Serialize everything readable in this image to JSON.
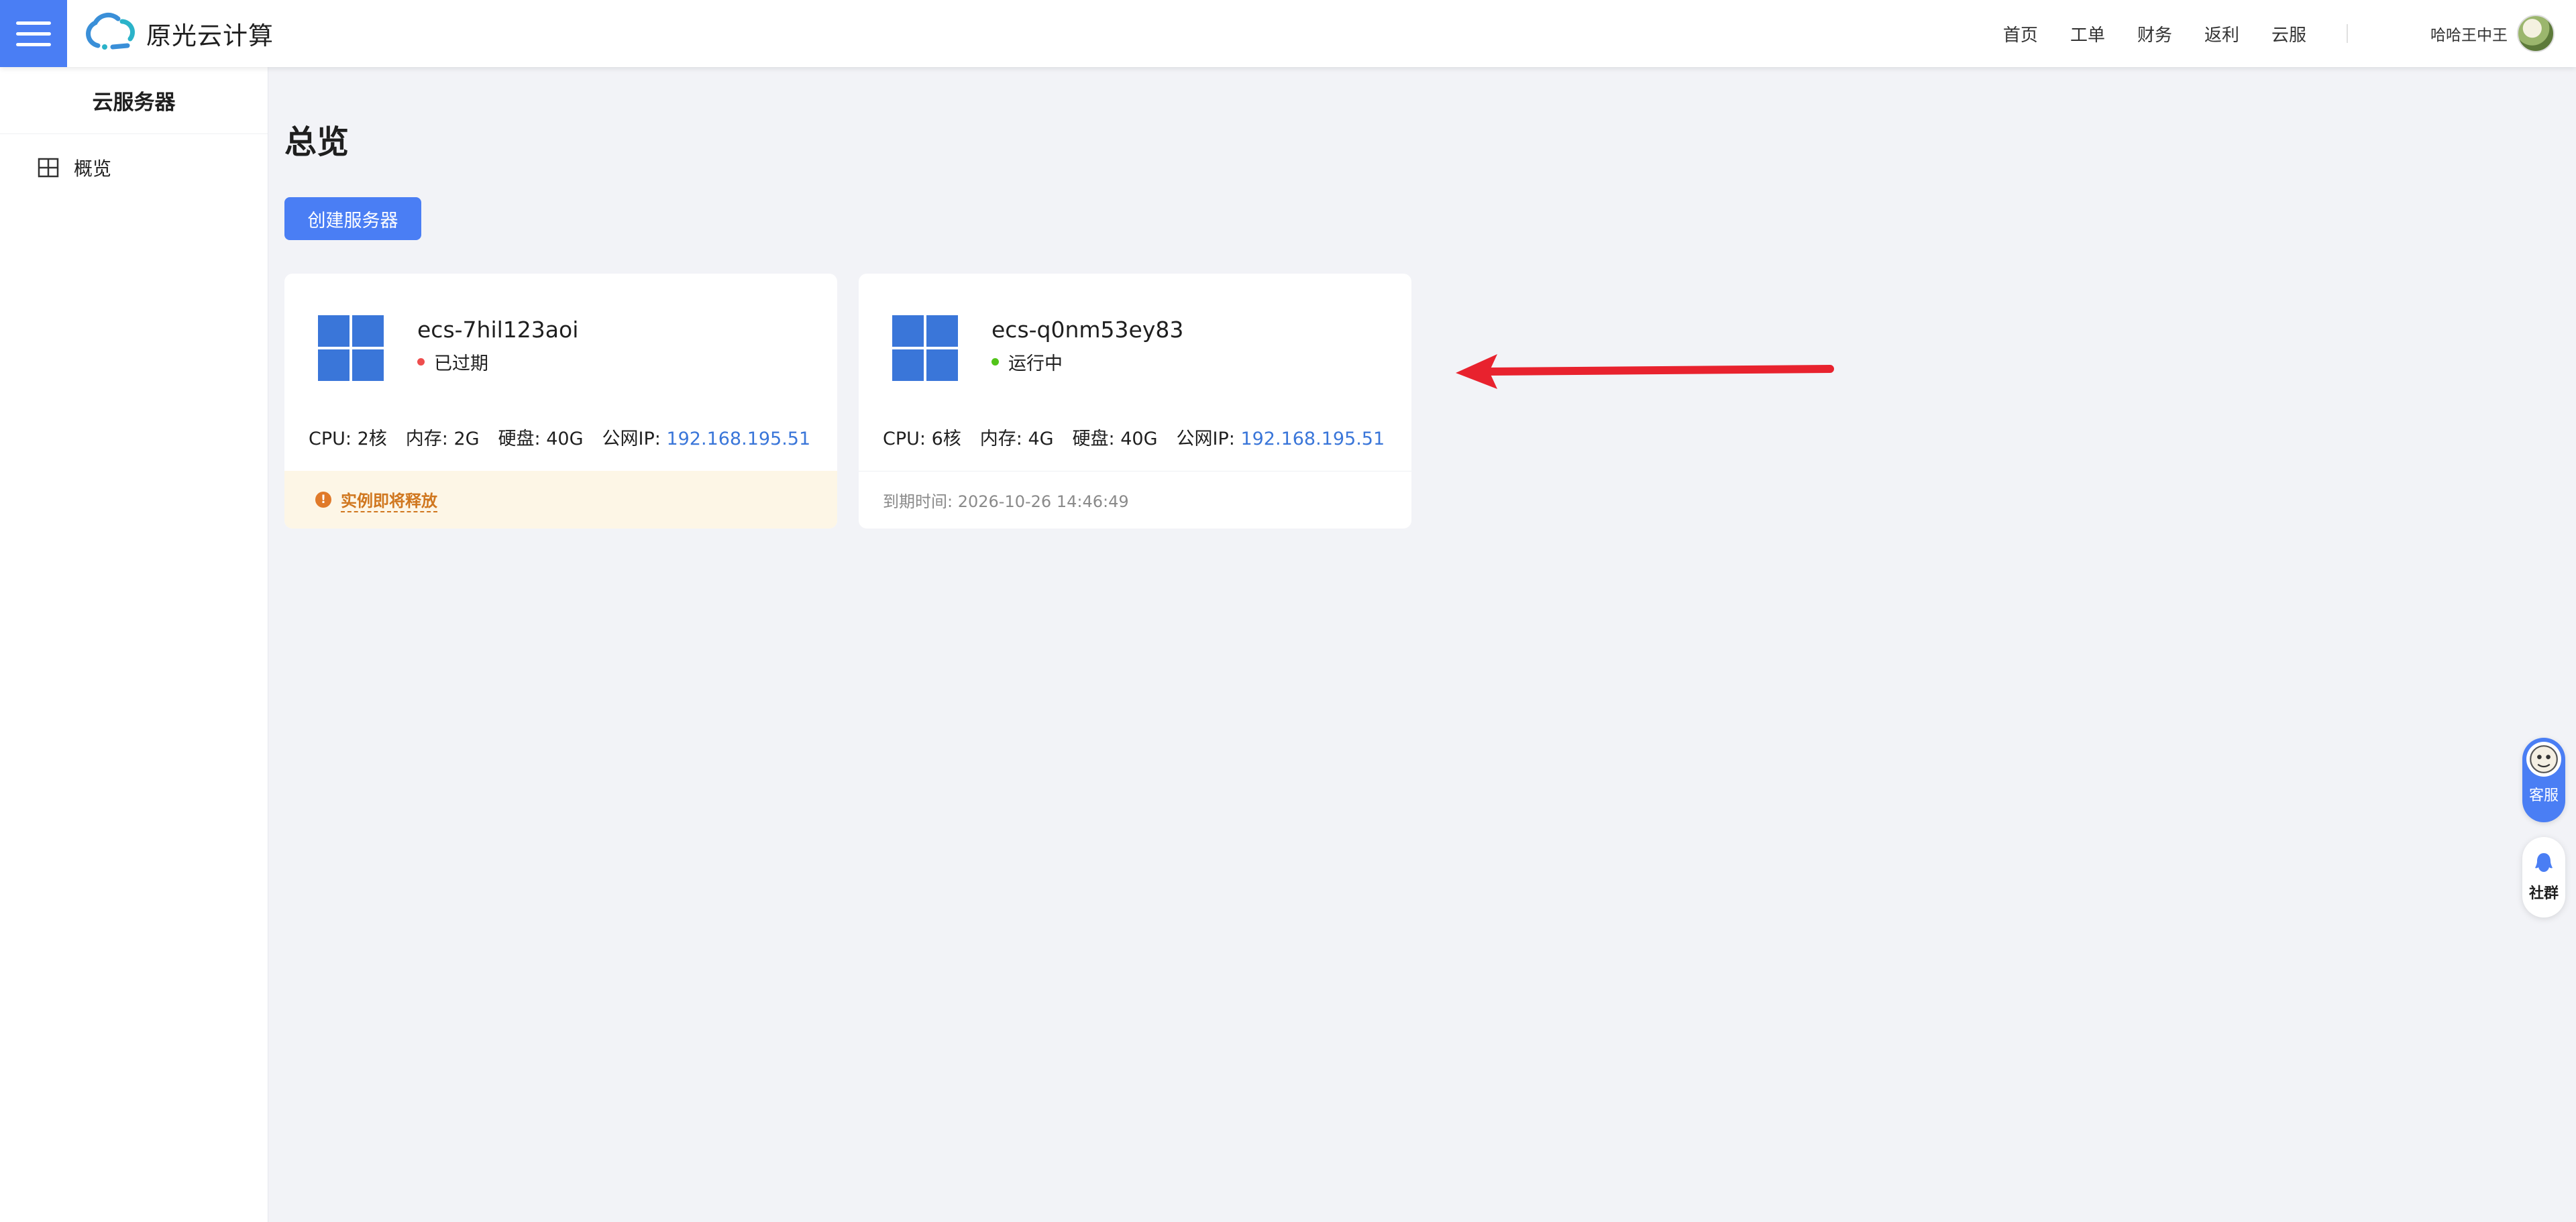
{
  "header": {
    "brand_name": "原光云计算",
    "nav": [
      "首页",
      "工单",
      "财务",
      "返利",
      "云服"
    ],
    "user_name": "哈哈王中王"
  },
  "sidebar": {
    "title": "云服务器",
    "items": [
      {
        "label": "概览",
        "icon": "grid-icon"
      }
    ]
  },
  "main": {
    "title": "总览",
    "create_button": "创建服务器",
    "cards": [
      {
        "name": "ecs-7hil123aoi",
        "status": "已过期",
        "status_color": "#ee4d4d",
        "cpu": "CPU: 2核",
        "memory": "内存: 2G",
        "disk": "硬盘: 40G",
        "ip_label": "公网IP: ",
        "ip": "192.168.195.51",
        "footer_icon": "!",
        "footer": "实例即将释放"
      },
      {
        "name": "ecs-q0nm53ey83",
        "status": "运行中",
        "status_color": "#52c41a",
        "cpu": "CPU: 6核",
        "memory": "内存: 4G",
        "disk": "硬盘: 40G",
        "ip_label": "公网IP: ",
        "ip": "192.168.195.51",
        "footer": "到期时间: 2026-10-26 14:46:49"
      }
    ]
  },
  "floating": {
    "service_label": "客服",
    "community_label": "社群"
  },
  "colors": {
    "accent": "#4a7ef4",
    "link": "#3a76d9",
    "warning_bg": "#fdf6e6",
    "warning_text": "#d0771f",
    "annotation_arrow": "#e8222e"
  }
}
